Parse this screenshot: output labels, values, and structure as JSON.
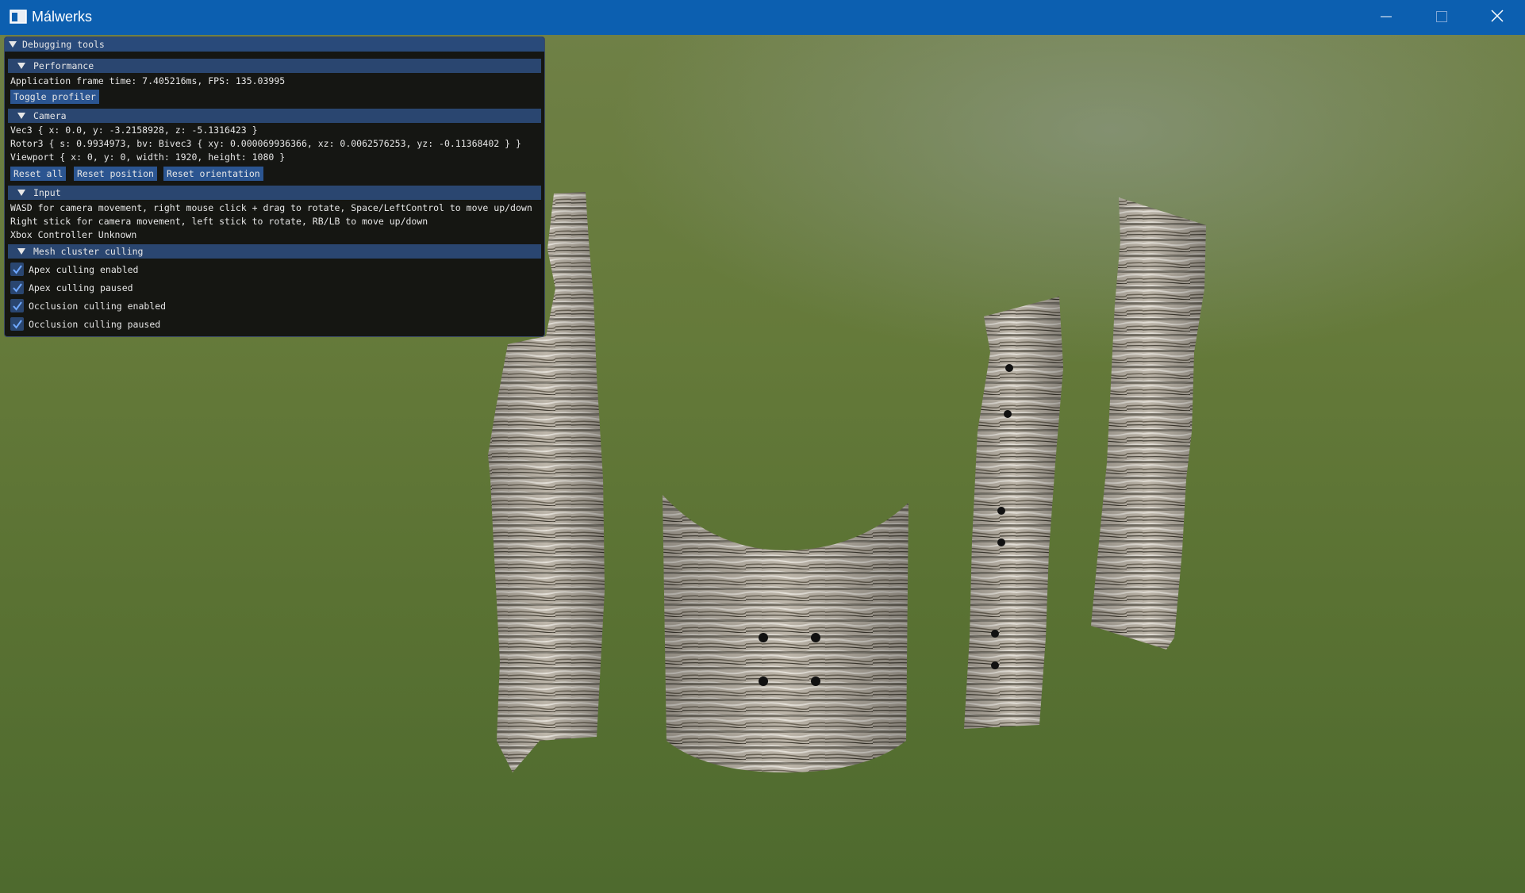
{
  "window": {
    "title": "Málwerks",
    "icons": {
      "app": "app-window-icon",
      "minimize": "minimize-icon",
      "maximize": "maximize-icon",
      "close": "close-icon"
    }
  },
  "panel": {
    "title": "Debugging tools",
    "performance": {
      "header": "Performance",
      "frame_time": "Application frame time: 7.405216ms, FPS: 135.03995",
      "toggle_profiler": "Toggle profiler"
    },
    "camera": {
      "header": "Camera",
      "position": "Vec3 { x: 0.0, y: -3.2158928, z: -5.1316423 }",
      "rotation": "Rotor3 { s: 0.9934973, bv: Bivec3 { xy: 0.000069936366, xz: 0.0062576253, yz: -0.11368402 } }",
      "viewport": "Viewport { x: 0, y: 0, width: 1920, height: 1080 }",
      "reset_all": "Reset all",
      "reset_position": "Reset position",
      "reset_orientation": "Reset orientation"
    },
    "input": {
      "header": "Input",
      "line1": "WASD for camera movement, right mouse click + drag to rotate, Space/LeftControl to move up/down",
      "line2": "Right stick for camera movement, left stick to rotate, RB/LB to move up/down",
      "line3": "Xbox Controller Unknown"
    },
    "mesh": {
      "header": "Mesh cluster culling",
      "options": [
        {
          "label": "Apex culling enabled",
          "checked": true
        },
        {
          "label": "Apex culling paused",
          "checked": true
        },
        {
          "label": "Occlusion culling enabled",
          "checked": true
        },
        {
          "label": "Occlusion culling paused",
          "checked": true
        }
      ]
    }
  },
  "scene": {
    "objects": [
      "bark-pillar-left",
      "bark-cylinder-center",
      "bark-pillar-right-near",
      "bark-pillar-right-far"
    ],
    "colors": {
      "bark_light": "#c8c2b8",
      "bark_dark": "#3e3a30",
      "ground": "#4f6b2f",
      "sky_glow": "#9aa39a"
    }
  }
}
